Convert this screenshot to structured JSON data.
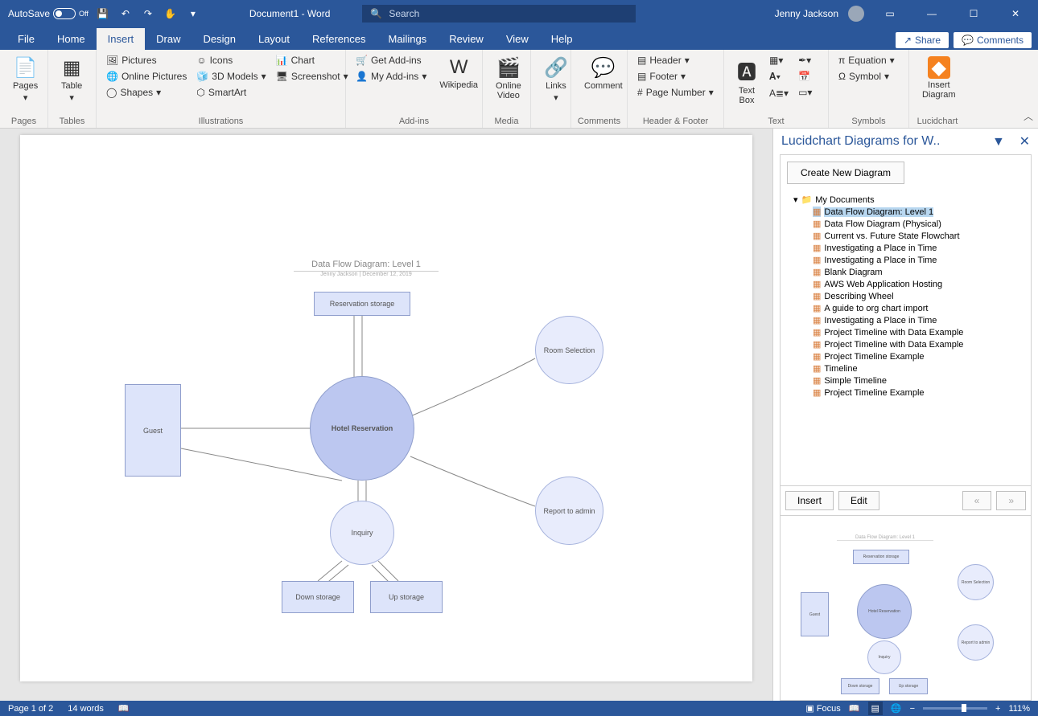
{
  "titlebar": {
    "autosave_label": "AutoSave",
    "autosave_state": "Off",
    "doc_title": "Document1 - Word",
    "search_placeholder": "Search",
    "user_name": "Jenny Jackson"
  },
  "tabs": {
    "items": [
      "File",
      "Home",
      "Insert",
      "Draw",
      "Design",
      "Layout",
      "References",
      "Mailings",
      "Review",
      "View",
      "Help"
    ],
    "active": "Insert",
    "share": "Share",
    "comments": "Comments"
  },
  "ribbon": {
    "pages": {
      "label": "Pages",
      "btn": "Pages"
    },
    "tables": {
      "label": "Tables",
      "btn": "Table"
    },
    "illustrations": {
      "label": "Illustrations",
      "pictures": "Pictures",
      "online_pictures": "Online Pictures",
      "shapes": "Shapes",
      "icons": "Icons",
      "models": "3D Models",
      "smartart": "SmartArt",
      "chart": "Chart",
      "screenshot": "Screenshot"
    },
    "addins": {
      "label": "Add-ins",
      "get": "Get Add-ins",
      "my": "My Add-ins",
      "wiki": "Wikipedia"
    },
    "media": {
      "label": "Media",
      "video": "Online\nVideo"
    },
    "links": {
      "label": "",
      "btn": "Links"
    },
    "comments": {
      "label": "Comments",
      "btn": "Comment"
    },
    "hf": {
      "label": "Header & Footer",
      "header": "Header",
      "footer": "Footer",
      "page_number": "Page Number"
    },
    "text": {
      "label": "Text",
      "textbox": "Text\nBox"
    },
    "symbols": {
      "label": "Symbols",
      "equation": "Equation",
      "symbol": "Symbol"
    },
    "lucid": {
      "label": "Lucidchart",
      "btn": "Insert\nDiagram"
    }
  },
  "diagram": {
    "title": "Data Flow Diagram: Level 1",
    "subtitle": "Jenny Jackson | December 12, 2019",
    "res_storage": "Reservation storage",
    "guest": "Guest",
    "hotel": "Hotel Reservation",
    "room_sel": "Room Selection",
    "report": "Report to admin",
    "inquiry": "Inquiry",
    "down": "Down storage",
    "up": "Up storage"
  },
  "pane": {
    "title": "Lucidchart Diagrams for W..",
    "create": "Create New Diagram",
    "root": "My Documents",
    "docs": [
      "Data Flow Diagram: Level 1",
      "Data Flow Diagram (Physical)",
      "Current vs. Future State Flowchart",
      "Investigating a Place in Time",
      "Investigating a Place in Time",
      "Blank Diagram",
      "AWS Web Application Hosting",
      "Describing Wheel",
      "A guide to org chart import",
      "Investigating a Place in Time",
      "Project Timeline with Data Example",
      "Project Timeline with Data Example",
      "Project Timeline Example",
      "Timeline",
      "Simple Timeline",
      "Project Timeline Example"
    ],
    "insert": "Insert",
    "edit": "Edit",
    "prev": "«",
    "next": "»"
  },
  "status": {
    "page": "Page 1 of 2",
    "words": "14 words",
    "focus": "Focus",
    "zoom": "111%"
  }
}
